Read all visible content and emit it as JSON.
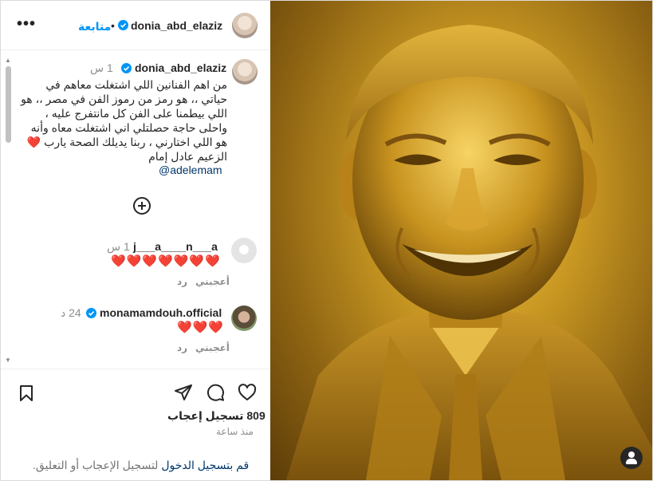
{
  "header": {
    "username": "donia_abd_elaziz",
    "follow_label": "متابعة",
    "separator": "•",
    "more_label": "•••"
  },
  "caption": {
    "username": "donia_abd_elaziz",
    "time": "1 س",
    "text": "من اهم الفنانين اللي اشتغلت معاهم في حياتي ،، هو رمز من رموز الفن في مصر ،، هو اللي بيطمنا على الفن كل مانتفرج عليه ، واحلى حاجة حصلتلي اني اشتغلت معاه وأنه هو اللي اختارني ، ربنا يديلك الصحة يارب ❤️ الزعيم عادل إمام",
    "mention": "@adelemam"
  },
  "comments": [
    {
      "username": "j___a____n___a",
      "time": "1 س",
      "text": "❤️❤️❤️❤️❤️❤️❤️",
      "like_label": "أعجبني",
      "reply_label": "رد"
    },
    {
      "username": "monamamdouh.official",
      "time": "24 د",
      "text": "❤️❤️❤️",
      "like_label": "أعجبني",
      "reply_label": "رد"
    }
  ],
  "footer": {
    "likes": "809 تسجيل إعجاب",
    "time_ago": "منذ ساعة",
    "login_link": "قم بتسجيل الدخول",
    "login_rest": "لتسجيل الإعجاب أو التعليق."
  },
  "colors": {
    "accent": "#0095f6",
    "verified": "#0095f6",
    "heart": "#e0245e",
    "muted": "#8e8e8e"
  },
  "icons": {
    "save": "bookmark-icon",
    "share": "paper-plane-icon",
    "comment": "comment-bubble-icon",
    "like": "heart-icon",
    "tags": "user-tag-icon",
    "add": "plus-circle-icon"
  }
}
